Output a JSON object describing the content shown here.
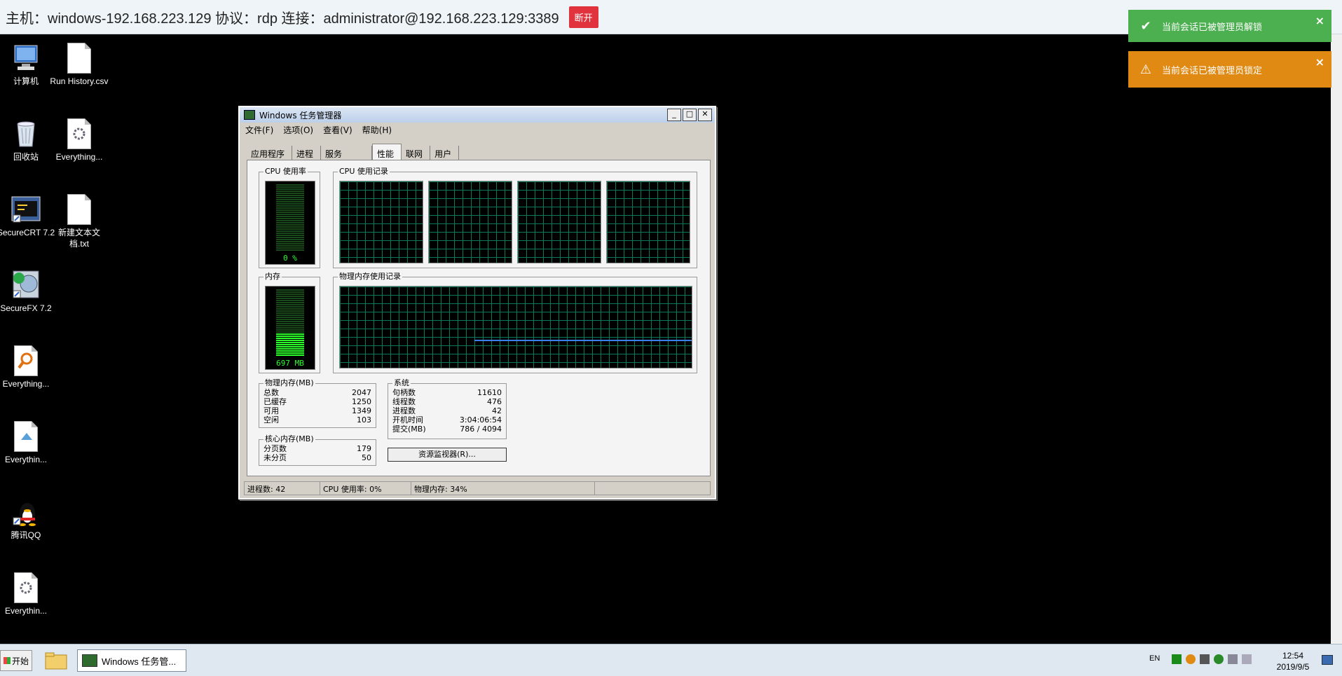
{
  "topbar": {
    "info": "主机：windows-192.168.223.129  协议：rdp  连接：administrator@192.168.223.129:3389",
    "disconnect": "断开"
  },
  "toasts": [
    {
      "text": "当前会话已被管理员解锁",
      "color": "#4caf50",
      "icon": "check-icon"
    },
    {
      "text": "当前会话已被管理员锁定",
      "color": "#e08a14",
      "icon": "warning-icon"
    }
  ],
  "desktop_icons": [
    {
      "label": "计算机",
      "icon": "computer-icon"
    },
    {
      "label": "Run History.csv",
      "icon": "document-icon"
    },
    {
      "label": "回收站",
      "icon": "recycle-bin-icon"
    },
    {
      "label": "Everything...",
      "icon": "document-gear-icon"
    },
    {
      "label": "SecureCRT 7.2",
      "icon": "securecrt-icon"
    },
    {
      "label": "新建文本文档.txt",
      "icon": "document-icon"
    },
    {
      "label": "SecureFX 7.2",
      "icon": "securefx-icon"
    },
    {
      "label": "Everything...",
      "icon": "everything-search-icon"
    },
    {
      "label": "Everythin...",
      "icon": "document-icon"
    },
    {
      "label": "腾讯QQ",
      "icon": "qq-penguin-icon"
    },
    {
      "label": "Everythin...",
      "icon": "document-gear-icon"
    }
  ],
  "taskmgr": {
    "title": "Windows 任务管理器",
    "menu": [
      "文件(F)",
      "选项(O)",
      "查看(V)",
      "帮助(H)"
    ],
    "tabs": [
      "应用程序",
      "进程",
      "服务",
      "性能",
      "联网",
      "用户"
    ],
    "active_tab": "性能",
    "cpu_usage_label": "CPU 使用率",
    "cpu_usage_value": "0 %",
    "cpu_history_label": "CPU 使用记录",
    "mem_label": "内存",
    "mem_value": "697 MB",
    "mem_fraction": 0.34,
    "mem_history_label": "物理内存使用记录",
    "phys_mem": {
      "title": "物理内存(MB)",
      "rows": [
        [
          "总数",
          "2047"
        ],
        [
          "已缓存",
          "1250"
        ],
        [
          "可用",
          "1349"
        ],
        [
          "空闲",
          "103"
        ]
      ]
    },
    "kernel_mem": {
      "title": "核心内存(MB)",
      "rows": [
        [
          "分页数",
          "179"
        ],
        [
          "未分页",
          "50"
        ]
      ]
    },
    "system": {
      "title": "系统",
      "rows": [
        [
          "句柄数",
          "11610"
        ],
        [
          "线程数",
          "476"
        ],
        [
          "进程数",
          "42"
        ],
        [
          "开机时间",
          "3:04:06:54"
        ],
        [
          "提交(MB)",
          "786 / 4094"
        ]
      ]
    },
    "resmon_button": "资源监视器(R)...",
    "status": [
      "进程数: 42",
      "CPU 使用率: 0%",
      "物理内存: 34%"
    ]
  },
  "taskbar": {
    "start": "开始",
    "task": "Windows 任务管...",
    "lang": "EN",
    "time": "12:54",
    "date": "2019/9/5"
  }
}
